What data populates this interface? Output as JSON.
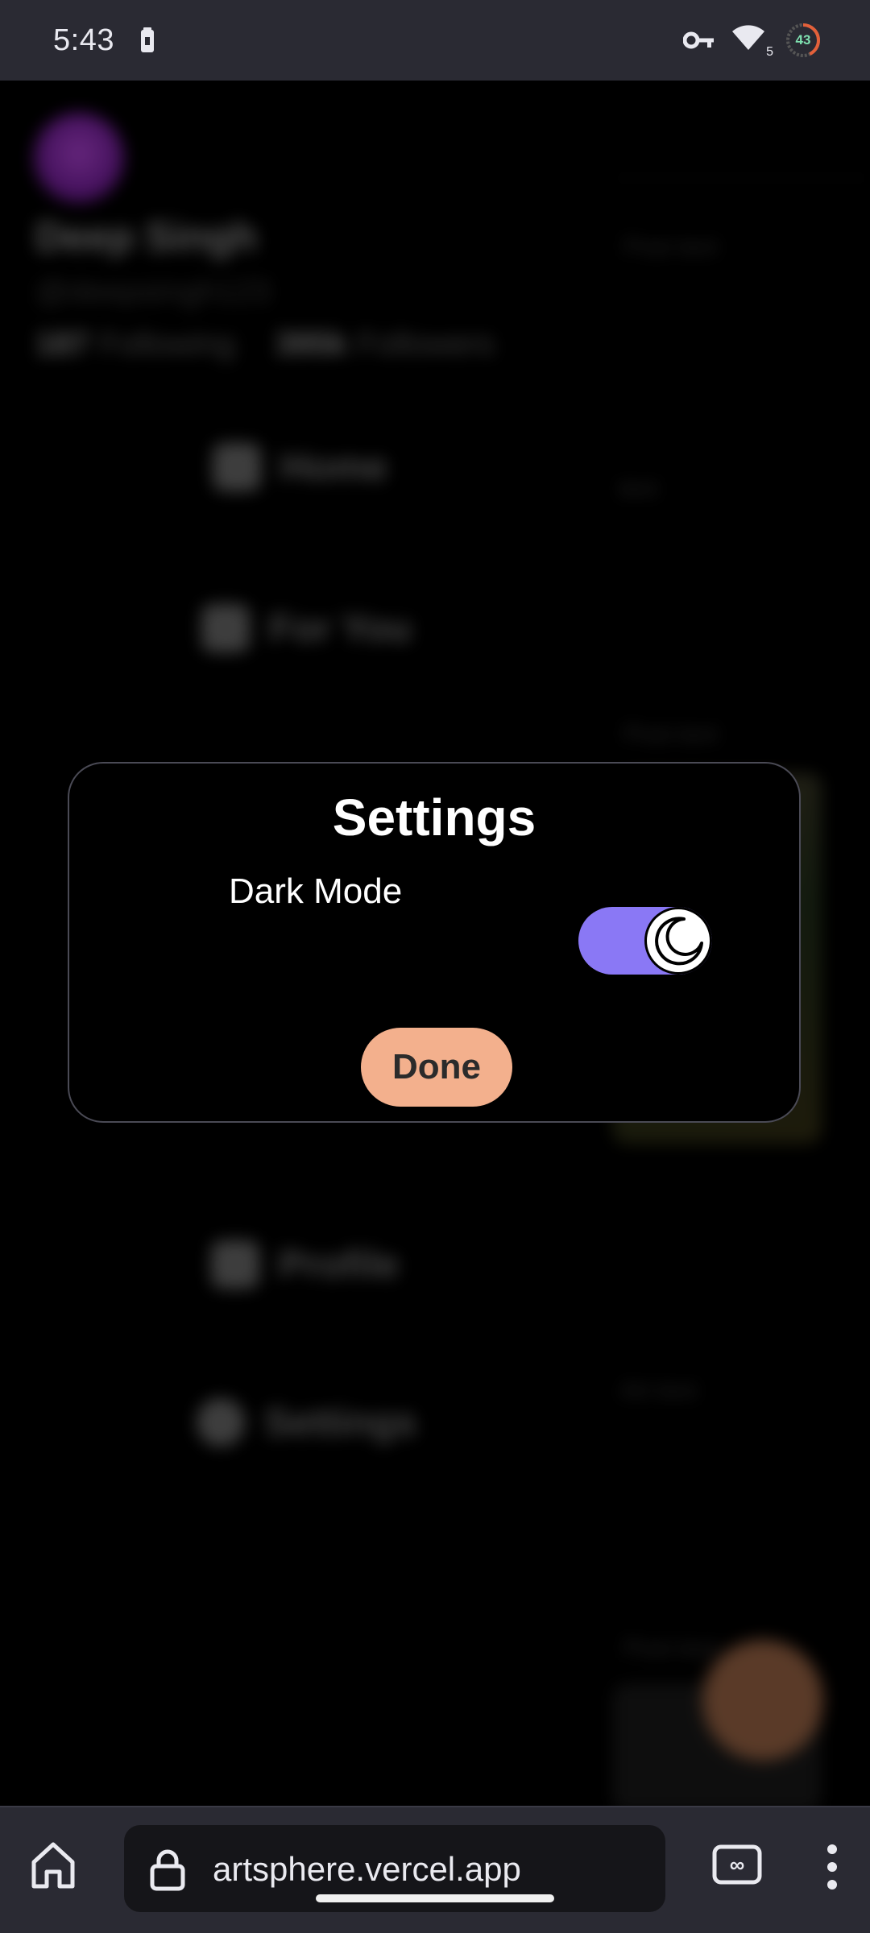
{
  "status_bar": {
    "time": "5:43",
    "wifi_subscript": "5",
    "ring_value": "43"
  },
  "background": {
    "profile_name": "Deep Singh",
    "profile_handle": "@deepsingh123",
    "following_count": "187",
    "following_label": "Following",
    "followers_count": "395k",
    "followers_label": "Followers",
    "nav_items": [
      "Home",
      "For You",
      "Profile",
      "Settings"
    ],
    "post_meta_1": "Post text",
    "post_meta_2": "text",
    "post_meta_3": "Post text",
    "post_meta_4": "Art text",
    "post_meta_5": "Post text"
  },
  "dialog": {
    "title": "Settings",
    "dark_mode_label": "Dark Mode",
    "dark_mode_enabled": true,
    "done_label": "Done"
  },
  "browser": {
    "url": "artsphere.vercel.app"
  },
  "colors": {
    "toggle_on": "#8a78f5",
    "done_button": "#f3b08d",
    "chrome_bar": "#2a2a33"
  }
}
